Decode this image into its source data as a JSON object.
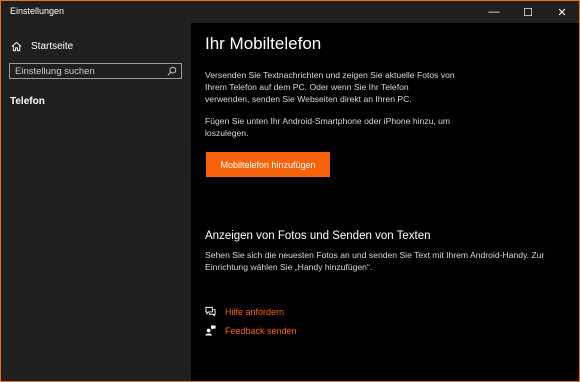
{
  "window": {
    "title": "Einstellungen",
    "controls": {
      "minimize": "—",
      "maximize": "☐",
      "close": "✕"
    }
  },
  "sidebar": {
    "home_label": "Startseite",
    "search_placeholder": "Einstellung suchen",
    "items": [
      {
        "label": "Telefon",
        "selected": true
      }
    ]
  },
  "main": {
    "title": "Ihr Mobiltelefon",
    "intro": "Versenden Sie Textnachrichten und zeigen Sie aktuelle Fotos von Ihrem Telefon auf dem PC. Oder wenn Sie Ihr Telefon verwenden, senden Sie Webseiten direkt an Ihren PC.",
    "add_prompt": "Fügen Sie unten Ihr Android-Smartphone oder iPhone hinzu, um loszulegen.",
    "add_button": "Mobiltelefon hinzufügen",
    "section_title": "Anzeigen von Fotos und Senden von Texten",
    "section_text": "Sehen Sie sich die neuesten Fotos an und senden Sie Text mit Ihrem Android-Handy. Zur Einrichtung wählen Sie „Handy hinzufügen“.",
    "links": [
      {
        "label": "Hilfe anfordern",
        "icon": "help-chat-icon"
      },
      {
        "label": "Feedback senden",
        "icon": "feedback-person-icon"
      }
    ]
  },
  "colors": {
    "accent": "#f7630c",
    "sidebar_bg": "#1f1f1f",
    "content_bg": "#000000"
  }
}
